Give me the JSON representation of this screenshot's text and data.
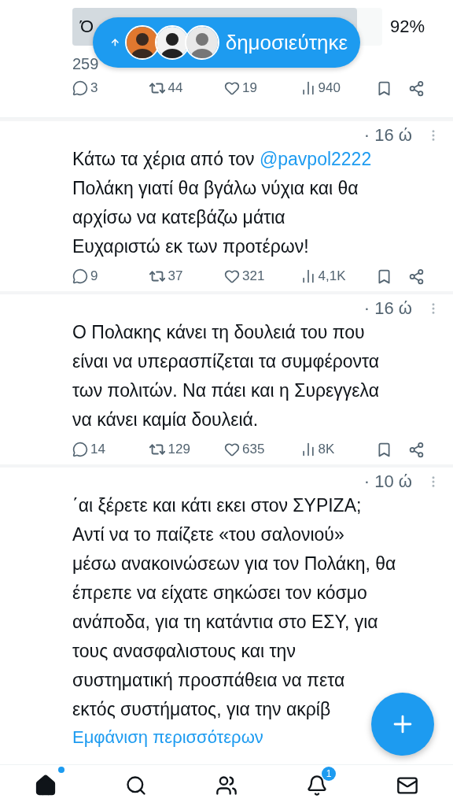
{
  "poll": {
    "option": {
      "label": "Ό",
      "percent": "92%",
      "level": 0.92
    },
    "meta": "259"
  },
  "new_posts_pill": {
    "label": "δημοσιεύτηκε"
  },
  "tweets": [
    {
      "time": "· 16 ώ",
      "lines": [
        [
          {
            "kind": "text",
            "text": "Κάτω τα χέρια από τον "
          },
          {
            "kind": "mention",
            "text": "@pavpol2222"
          }
        ],
        [
          {
            "kind": "text",
            "text": "Πολάκη γιατί θα βγάλω νύχια και θα"
          }
        ],
        [
          {
            "kind": "text",
            "text": "αρχίσω να κατεβάζω μάτια"
          }
        ],
        [
          {
            "kind": "text",
            "text": "Ευχαριστώ εκ των προτέρων!"
          }
        ]
      ],
      "stats": {
        "replies": "9",
        "reposts": "37",
        "likes": "321",
        "views": "4,1K"
      }
    },
    {
      "time": "· 16 ώ",
      "lines": [
        [
          {
            "kind": "text",
            "text": "Ο Πολακης κάνει τη δουλειά του που"
          }
        ],
        [
          {
            "kind": "text",
            "text": "είναι να υπερασπίζεται τα συμφέροντα"
          }
        ],
        [
          {
            "kind": "text",
            "text": "των πολιτών. Να πάει και η Συρεγγελα"
          }
        ],
        [
          {
            "kind": "text",
            "text": "να κάνει καμία δουλειά."
          }
        ]
      ],
      "stats": {
        "replies": "14",
        "reposts": "129",
        "likes": "635",
        "views": "8K"
      }
    },
    {
      "time": "· 10 ώ",
      "lines": [
        [
          {
            "kind": "text",
            "text": "΄αι ξέρετε και κάτι εκει στον ΣΥΡΙΖΑ;"
          }
        ],
        [
          {
            "kind": "text",
            "text": "Αντί να το παίζετε «του σαλονιού»"
          }
        ],
        [
          {
            "kind": "text",
            "text": "μέσω ανακοινώσεων για τον Πολάκη, θα"
          }
        ],
        [
          {
            "kind": "text",
            "text": "έπρεπε να είχατε σηκώσει τον κόσμο"
          }
        ],
        [
          {
            "kind": "text",
            "text": "ανάποδα, για τη κατάντια στο ΕΣΥ, για"
          }
        ],
        [
          {
            "kind": "text",
            "text": "τους ανασφαλιστους και την"
          }
        ],
        [
          {
            "kind": "text",
            "text": "συστηματική προσπάθεια να πετα"
          }
        ],
        [
          {
            "kind": "text",
            "text": "εκτός συστήματος, για την ακρίβ"
          }
        ]
      ],
      "show_more": "Εμφάνιση περισσότερων"
    }
  ],
  "top_stats": {
    "replies": "3",
    "reposts": "44",
    "likes": "19",
    "views": "940"
  },
  "nav": [
    {
      "kind": "home",
      "selected": true,
      "dot": true
    },
    {
      "kind": "search",
      "selected": false
    },
    {
      "kind": "communities",
      "selected": false
    },
    {
      "kind": "notifications",
      "selected": false,
      "badge": "1"
    },
    {
      "kind": "messages",
      "selected": false
    }
  ]
}
